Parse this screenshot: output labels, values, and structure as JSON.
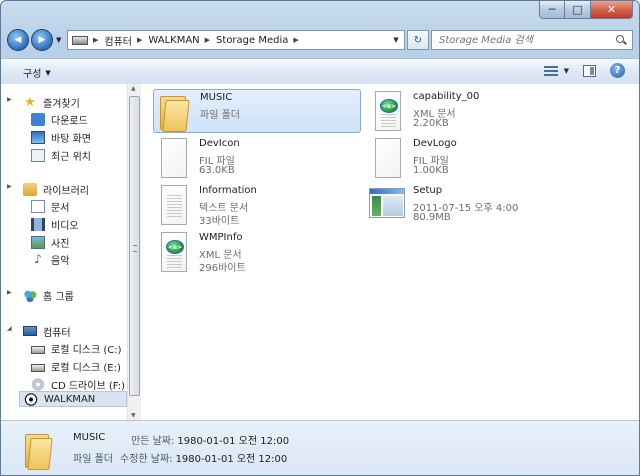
{
  "window": {
    "min_label": "─",
    "max_label": "□",
    "close_label": "✕"
  },
  "nav": {
    "back_label": "◀",
    "forward_label": "▶",
    "dropdown_label": "▼",
    "breadcrumb": [
      "컴퓨터",
      "WALKMAN",
      "Storage Media"
    ],
    "refresh_label": "↻",
    "search_placeholder": "Storage Media 검색"
  },
  "toolbar": {
    "organize_label": "구성"
  },
  "sidebar": {
    "favorites": {
      "label": "즐겨찾기",
      "items": [
        "다운로드",
        "바탕 화면",
        "최근 위치"
      ]
    },
    "libraries": {
      "label": "라이브러리",
      "items": [
        "문서",
        "비디오",
        "사진",
        "음악"
      ]
    },
    "homegroup": {
      "label": "홈 그룹"
    },
    "computer": {
      "label": "컴퓨터",
      "items": [
        "로컬 디스크 (C:)",
        "로컬 디스크 (E:)",
        "CD 드라이브 (F:)",
        "WALKMAN"
      ]
    }
  },
  "files": [
    {
      "name": "MUSIC",
      "type": "파일 폴더",
      "size": "",
      "icon": "folder-icon",
      "selected": true
    },
    {
      "name": "capability_00",
      "type": "XML 문서",
      "size": "2.20KB",
      "icon": "xml-file-icon"
    },
    {
      "name": "DevIcon",
      "type": "FIL 파일",
      "size": "63.0KB",
      "icon": "file-icon"
    },
    {
      "name": "DevLogo",
      "type": "FIL 파일",
      "size": "1.00KB",
      "icon": "file-icon"
    },
    {
      "name": "Information",
      "type": "텍스트 문서",
      "size": "33바이트",
      "icon": "text-file-icon"
    },
    {
      "name": "Setup",
      "type": "2011-07-15 오후 4:00",
      "size": "80.9MB",
      "icon": "application-icon"
    },
    {
      "name": "WMPInfo",
      "type": "XML 문서",
      "size": "296바이트",
      "icon": "xml-file-icon"
    }
  ],
  "details": {
    "name": "MUSIC",
    "type": "파일 폴더",
    "created_label": "만든 날짜:",
    "created_value": "1980-01-01 오전 12:00",
    "modified_label": "수정한 날짜:",
    "modified_value": "1980-01-01 오전 12:00"
  }
}
